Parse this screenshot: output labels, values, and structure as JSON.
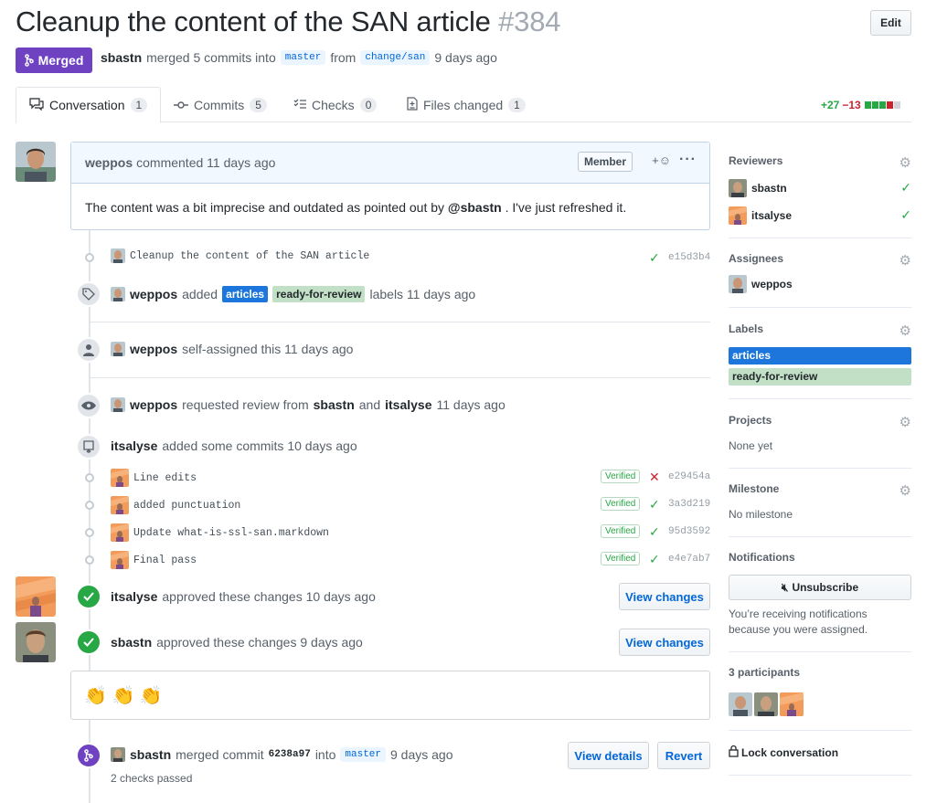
{
  "header": {
    "title": "Cleanup the content of the SAN article",
    "number": "#384",
    "edit_label": "Edit",
    "state": "Merged",
    "author": "sbastn",
    "summary_mid": "merged 5 commits into",
    "base_branch": "master",
    "from_word": "from",
    "head_branch": "change/san",
    "time": "9 days ago"
  },
  "tabs": [
    {
      "label": "Conversation",
      "count": "1",
      "icon": "comment-icon"
    },
    {
      "label": "Commits",
      "count": "5",
      "icon": "commit-icon"
    },
    {
      "label": "Checks",
      "count": "0",
      "icon": "checks-icon"
    },
    {
      "label": "Files changed",
      "count": "1",
      "icon": "file-diff-icon"
    }
  ],
  "diffstat": {
    "additions": "+27",
    "deletions": "−13"
  },
  "comment": {
    "author": "weppos",
    "action": "commented 11 days ago",
    "role": "Member",
    "body_before": "The content was a bit imprecise and outdated as pointed out by",
    "mention": "@sbastn",
    "body_after": ". I've just refreshed it."
  },
  "first_commit": {
    "message": "Cleanup the content of the SAN article",
    "sha": "e15d3b4"
  },
  "events": {
    "labels": {
      "actor": "weppos",
      "verb": "added",
      "label1": "articles",
      "label2": "ready-for-review",
      "tail": "labels 11 days ago"
    },
    "assign": {
      "actor": "weppos",
      "text": "self-assigned this 11 days ago"
    },
    "review_request": {
      "actor": "weppos",
      "text": "requested review from",
      "r1": "sbastn",
      "and": "and",
      "r2": "itsalyse",
      "time": "11 days ago"
    },
    "added_commits": {
      "actor": "itsalyse",
      "text": "added some commits 10 days ago"
    }
  },
  "commits": [
    {
      "message": "Line edits",
      "verified": "Verified",
      "status": "fail",
      "sha": "e29454a"
    },
    {
      "message": "added punctuation",
      "verified": "Verified",
      "status": "ok",
      "sha": "3a3d219"
    },
    {
      "message": "Update what-is-ssl-san.markdown",
      "verified": "Verified",
      "status": "ok",
      "sha": "95d3592"
    },
    {
      "message": "Final pass",
      "verified": "Verified",
      "status": "ok",
      "sha": "e4e7ab7"
    }
  ],
  "approvals": [
    {
      "actor": "itsalyse",
      "text": "approved these changes 10 days ago",
      "button": "View changes"
    },
    {
      "actor": "sbastn",
      "text": "approved these changes 9 days ago",
      "button": "View changes"
    }
  ],
  "claps": "👏 👏 👏",
  "merge": {
    "actor": "sbastn",
    "text": "merged commit",
    "sha": "6238a97",
    "into": "into",
    "branch": "master",
    "time": "9 days ago",
    "checks": "2 checks passed",
    "details_btn": "View details",
    "revert_btn": "Revert"
  },
  "sidebar": {
    "reviewers_title": "Reviewers",
    "reviewers": [
      "sbastn",
      "itsalyse"
    ],
    "assignees_title": "Assignees",
    "assignees": [
      "weppos"
    ],
    "labels_title": "Labels",
    "labels": [
      "articles",
      "ready-for-review"
    ],
    "projects_title": "Projects",
    "projects_value": "None yet",
    "milestone_title": "Milestone",
    "milestone_value": "No milestone",
    "notifications_title": "Notifications",
    "unsubscribe": "Unsubscribe",
    "notif_reason": "You’re receiving notifications because you were assigned.",
    "participants_title": "3 participants",
    "lock": "Lock conversation"
  },
  "colors": {
    "merged": "#6f42c1",
    "label_articles": "#1d76db",
    "label_ready": "#c2e0c6",
    "success": "#28a745",
    "danger": "#cb2431",
    "link": "#0366d6"
  }
}
